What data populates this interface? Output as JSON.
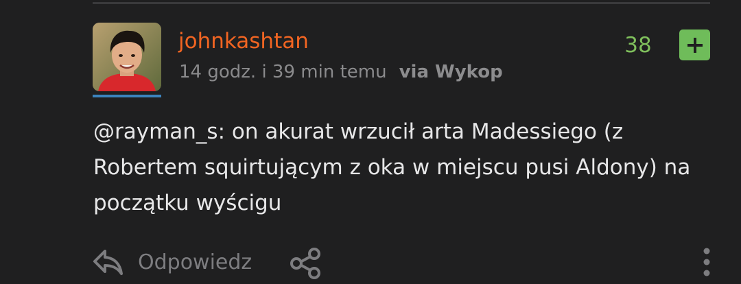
{
  "entry": {
    "author": "johnkashtan",
    "time": "14 godz. i 39 min temu",
    "via": "via Wykop",
    "score": "38",
    "body": "@rayman_s: on akurat wrzucił arta Madessiego (z Robertem squirtującym z oka w miejscu pusi Aldony) na początku wyścigu"
  },
  "actions": {
    "reply_label": "Odpowiedz"
  },
  "colors": {
    "username": "#f26522",
    "score": "#7fbf5c",
    "plus_button": "#6fbc5a",
    "avatar_underline": "#3c83bd",
    "background": "#1f1f20"
  },
  "icons": {
    "plus": "plus-icon",
    "reply": "reply-arrow-icon",
    "share": "share-icon",
    "more": "more-vertical-icon"
  }
}
